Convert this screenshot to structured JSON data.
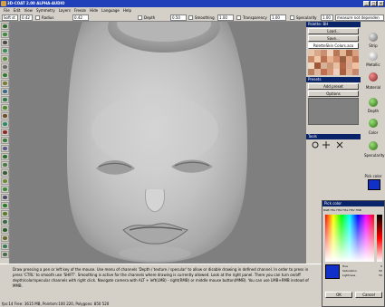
{
  "window": {
    "title": "3D-COAT 2.00 ALPHA-AUDIO",
    "buttons": [
      "_",
      "□",
      "×"
    ]
  },
  "menu": [
    "File",
    "Edit",
    "View",
    "Symmetry",
    "Layers",
    "Freeze",
    "Hide",
    "Language",
    "Help"
  ],
  "toolbar": {
    "brush_label": "Soft st",
    "brush_value": "0.42",
    "radius_label": "Radius",
    "radius_value": "0.42",
    "depth_label": "Depth",
    "depth_value": "0.50",
    "smoothing_label": "Smoothing",
    "smoothing_value": "1.00",
    "transparency_label": "Transparency",
    "transparency_value": "1.00",
    "specularity_label": "Specularity",
    "specularity_value": "1.00",
    "measure_label": "measure not dependen"
  },
  "right_panel": {
    "load": "Load...",
    "save": "Save...",
    "palette_title": "Palette: BH",
    "palette_name": "PaletteSkin Colors.aco",
    "presets_title": "Presets",
    "add_preset": "Add preset",
    "options": "Options",
    "tools_title": "Tools",
    "side_labels": [
      "Strip",
      "Metallic",
      "Material",
      "Depth",
      "Color",
      "Specularity",
      "Pick color"
    ]
  },
  "color_window": {
    "title": "Pick color",
    "tabs": [
      "RGB",
      "HSL",
      "HSV",
      "HSL",
      "HSV",
      "HSB"
    ],
    "labels": [
      "Hue",
      "Saturation",
      "Lightness"
    ],
    "values": [
      "0",
      "50",
      "50"
    ],
    "bottom_buttons": [
      "OK",
      "Cancel"
    ]
  },
  "status": {
    "help_text": "Draw pressing a pen or left key of the mouse. Use menu of channels 'Depth / texture / specular' to allow or disable drawing in defined channel. In order to press in press 'CTRL' to smooth use 'SHIFT'. Smoothing is active for the channels where drawing is currently allowed. Look at the right panel. There you can turn on/off depth/color/specular channels with right click. Navigate camera with ALT + left(LMB) - right(RMB) or middle mouse button(MMB). You can use LMB+RMB instead of MMB.",
    "stats": "fps:14    Free: 3615 MB, Pointsm:100 220, Polygons: 850 520"
  },
  "colors": {
    "title_blue": "#1f40b8",
    "panel_gray": "#d4d0c8",
    "viewport_gray": "#7f7f7f",
    "active_color": "#1030c8"
  }
}
